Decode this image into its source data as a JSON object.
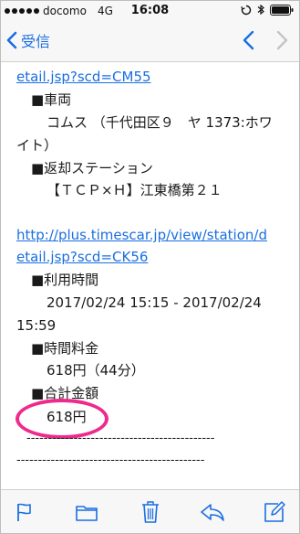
{
  "status": {
    "carrier": "docomo",
    "network": "4G",
    "time": "16:08"
  },
  "nav": {
    "back_label": "受信"
  },
  "email": {
    "link1_tail": "etail.jsp?scd=CM55",
    "vehicle_header": "■車両",
    "vehicle_value_1": "コムス （千代田区９　ヤ 1373:ホワ",
    "vehicle_value_2": "イト）",
    "return_header": "■返却ステーション",
    "return_value": "【ＴＣＰ×Ｈ】江東橋第２１",
    "link2_line1": "http://plus.timescar.jp/view/station/d",
    "link2_line2": "etail.jsp?scd=CK56",
    "usage_header": "■利用時間",
    "usage_value_1": "2017/02/24 15:15 - 2017/02/24",
    "usage_value_2": "15:59",
    "time_fee_header": "■時間料金",
    "time_fee_value": "618円（44分）",
    "total_header": "■合計金額",
    "total_value": "618円",
    "separator_1": "--------------------------------------------",
    "separator_2": "--------------------------------------------"
  },
  "colors": {
    "accent": "#1a6fe0",
    "highlight_circle": "#ee2b8d"
  },
  "toolbar": {
    "icons": [
      "flag-icon",
      "folder-icon",
      "trash-icon",
      "reply-icon",
      "compose-icon"
    ]
  }
}
